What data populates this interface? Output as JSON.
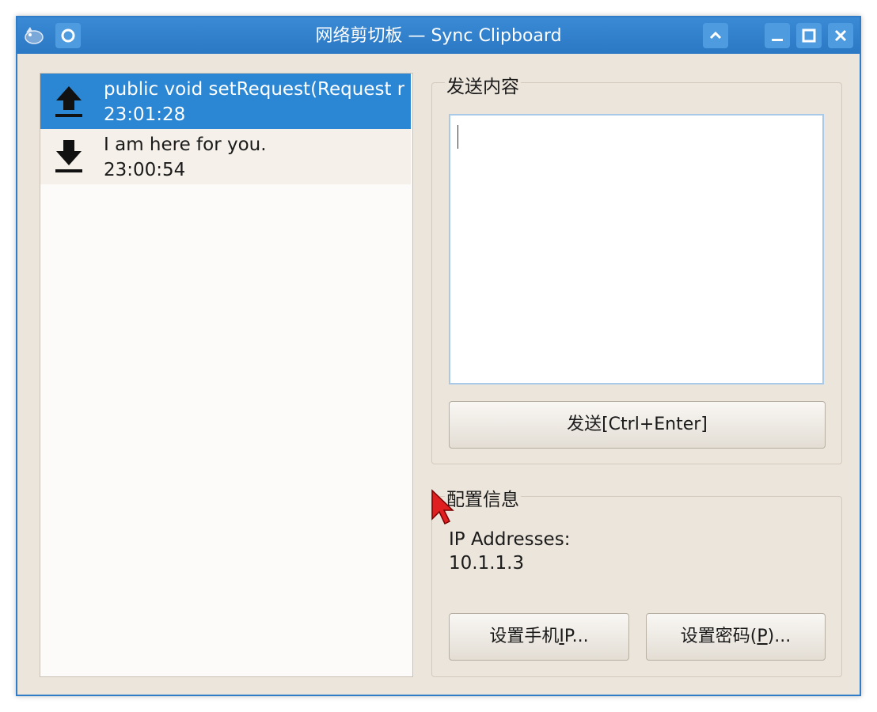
{
  "window": {
    "title": "网络剪切板 — Sync Clipboard",
    "titlebar_buttons": {
      "app_icon": "app-icon",
      "pin": "pin-icon",
      "shade": "chevron-up-icon",
      "minimize": "minimize-icon",
      "maximize": "maximize-icon",
      "close": "close-icon"
    },
    "accent_color": "#2b78c4"
  },
  "history": {
    "items": [
      {
        "icon": "upload-icon",
        "text": "public void setRequest(Request r",
        "time": "23:01:28",
        "selected": true
      },
      {
        "icon": "download-icon",
        "text": "I am here for you.",
        "time": "23:00:54",
        "selected": false
      }
    ],
    "selected_color": "#2b86d4"
  },
  "send": {
    "group_title": "发送内容",
    "input_value": "",
    "button_label": "发送[Ctrl+Enter]"
  },
  "config": {
    "group_title": "配置信息",
    "ip_label": "IP Addresses:",
    "ip_value": "10.1.1.3",
    "phone_ip_button": {
      "prefix": "设置手机",
      "mnemonic": "I",
      "suffix": "P..."
    },
    "password_button": {
      "prefix": "设置密码(",
      "mnemonic": "P",
      "suffix": ")..."
    }
  }
}
